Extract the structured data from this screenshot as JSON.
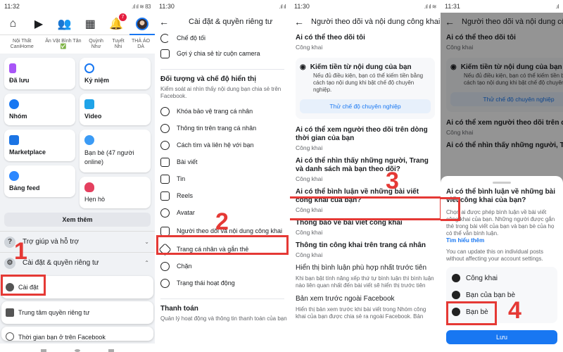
{
  "panel1": {
    "time": "11:32",
    "status_right": ".ıl ıl ≋ 83",
    "notification_count": "7",
    "stories": [
      "Nội Thất CaniHome",
      "Ăn Vặt Bình Tân ✅",
      "Quỳnh Như",
      "Tuyết Nhi",
      "THẢ ÁO DÀ"
    ],
    "cards_left": [
      "Đã lưu",
      "Nhóm",
      "Marketplace",
      "Bảng feed"
    ],
    "cards_right": [
      "Kỷ niệm",
      "Video",
      "Bạn bè (47 người online)",
      "Hẹn hò"
    ],
    "see_more": "Xem thêm",
    "help": "Trợ giúp và hỗ trợ",
    "settings_privacy": "Cài đặt & quyền riêng tư",
    "sub_settings": "Cài đặt",
    "sub_privacy_center": "Trung tâm quyền riêng tư",
    "sub_time": "Thời gian bạn ở trên Facebook",
    "step": "1"
  },
  "panel2": {
    "time": "11:30",
    "title": "Cài đặt & quyền riêng tư",
    "top_items": [
      "Chế độ tối",
      "Gợi ý chia sẻ từ cuộn camera"
    ],
    "section_title": "Đối tượng và chế độ hiển thị",
    "section_desc": "Kiểm soát ai nhìn thấy nội dung bạn chia sẻ trên Facebook.",
    "items": [
      "Khóa bảo vệ trang cá nhân",
      "Thông tin trên trang cá nhân",
      "Cách tìm và liên hệ với bạn",
      "Bài viết",
      "Tin",
      "Reels",
      "Avatar",
      "Người theo dõi và nội dung công khai",
      "Trang cá nhân và gắn thẻ",
      "Chặn",
      "Trạng thái hoạt động"
    ],
    "payment_title": "Thanh toán",
    "payment_desc": "Quản lý hoạt động và thông tin thanh toán của bạn",
    "step": "2"
  },
  "panel3": {
    "time": "11:30",
    "title": "Người theo dõi và nội dung công khai",
    "item0_title": "Ai có thể theo dõi tôi",
    "item0_value": "Công khai",
    "promo_title": "Kiếm tiền từ nội dung của bạn",
    "promo_desc": "Nếu đủ điều kiện, bạn có thể kiếm tiền bằng cách tạo nội dung khi bật chế độ chuyên nghiệp.",
    "promo_button": "Thử chế độ chuyên nghiệp",
    "items": [
      {
        "title": "Ai có thể xem người theo dõi trên dòng thời gian của bạn",
        "value": "Công khai"
      },
      {
        "title": "Ai có thể nhìn thấy những người, Trang và danh sách mà bạn theo dõi?",
        "value": "Công khai"
      },
      {
        "title": "Ai có thể bình luận về những bài viết công khai của bạn?",
        "value": "Công khai"
      },
      {
        "title": "Thông báo về bài viết công khai",
        "value": "Công khai"
      },
      {
        "title": "Thông tin công khai trên trang cá nhân",
        "value": "Công khai"
      }
    ],
    "best_comments_title": "Hiển thị bình luận phù hợp nhất trước tiên",
    "best_comments_desc": "Khi bạn bật tính năng xếp thứ tự bình luận thì bình luận nào liên quan nhất đến bài viết sẽ hiển thị trước tiên",
    "preview_title": "Bản xem trước ngoài Facebook",
    "preview_desc": "Hiển thị bản xem trước khi bài viết trong Nhóm công khai của bạn được chia sẻ ra ngoài Facebook. Bản",
    "step": "3"
  },
  "panel4": {
    "time": "11:31",
    "title": "Người theo dõi và nội dung công khai",
    "bg_item0_title": "Ai có thể theo dõi tôi",
    "bg_item0_value": "Công khai",
    "bg_promo_title": "Kiếm tiền từ nội dung của bạn",
    "bg_promo_desc": "Nếu đủ điều kiện, bạn có thể kiếm tiền bằng cách tạo nội dung khi bật chế độ chuyên nghiệp.",
    "bg_promo_button": "Thử chế độ chuyên nghiệp",
    "bg_item1_title": "Ai có thể xem người theo dõi trên dòng thời gian của bạn",
    "bg_item1_value": "Công khai",
    "bg_item2_title": "Ai có thể nhìn thấy những người, Trang và danh sách mà bạn theo dõi?",
    "sheet_title": "Ai có thể bình luận về những bài viết công khai của bạn?",
    "sheet_desc": "Chọn ai được phép bình luận về bài viết công khai của bạn. Những người được gắn thẻ trong bài viết của bạn và bạn bè của họ có thể vẫn bình luận.",
    "learn_more": "Tìm hiểu thêm",
    "sheet_note": "You can update this on individual posts without affecting your account settings.",
    "options": [
      "Công khai",
      "Bạn của bạn bè",
      "Bạn bè"
    ],
    "save": "Lưu",
    "step": "4"
  },
  "colors": {
    "accent": "#1877f2",
    "highlight": "#e53935",
    "badge": "#e41e3f"
  }
}
